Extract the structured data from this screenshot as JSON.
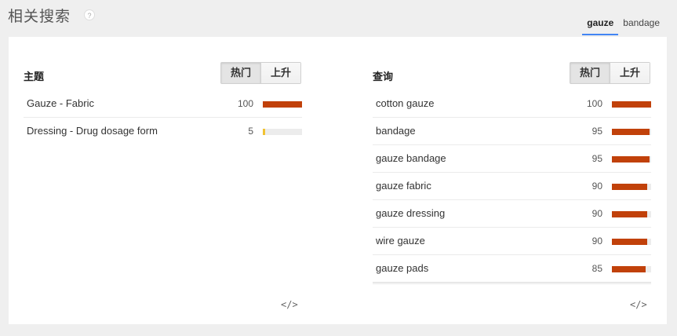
{
  "header": {
    "title": "相关搜索",
    "help_icon": "?",
    "tabs": [
      {
        "label": "gauze",
        "active": true
      },
      {
        "label": "bandage",
        "active": false
      }
    ]
  },
  "topics": {
    "title": "主题",
    "toggle": {
      "hot": "热门",
      "rising": "上升",
      "selected": "hot"
    },
    "rows": [
      {
        "label": "Gauze - Fabric",
        "value": "100",
        "level": 100
      },
      {
        "label": "Dressing - Drug dosage form",
        "value": "5",
        "level": 5
      }
    ],
    "embed_icon": "</>"
  },
  "queries": {
    "title": "查询",
    "toggle": {
      "hot": "热门",
      "rising": "上升",
      "selected": "hot"
    },
    "rows": [
      {
        "label": "cotton gauze",
        "value": "100",
        "level": 100
      },
      {
        "label": "bandage",
        "value": "95",
        "level": 95
      },
      {
        "label": "gauze bandage",
        "value": "95",
        "level": 95
      },
      {
        "label": "gauze fabric",
        "value": "90",
        "level": 90
      },
      {
        "label": "gauze dressing",
        "value": "90",
        "level": 90
      },
      {
        "label": "wire gauze",
        "value": "90",
        "level": 90
      },
      {
        "label": "gauze pads",
        "value": "85",
        "level": 85
      }
    ],
    "embed_icon": "</>"
  },
  "colors": {
    "bar": "#c1410a",
    "bar_low": "#f1c232",
    "tab_underline": "#4285f4"
  }
}
